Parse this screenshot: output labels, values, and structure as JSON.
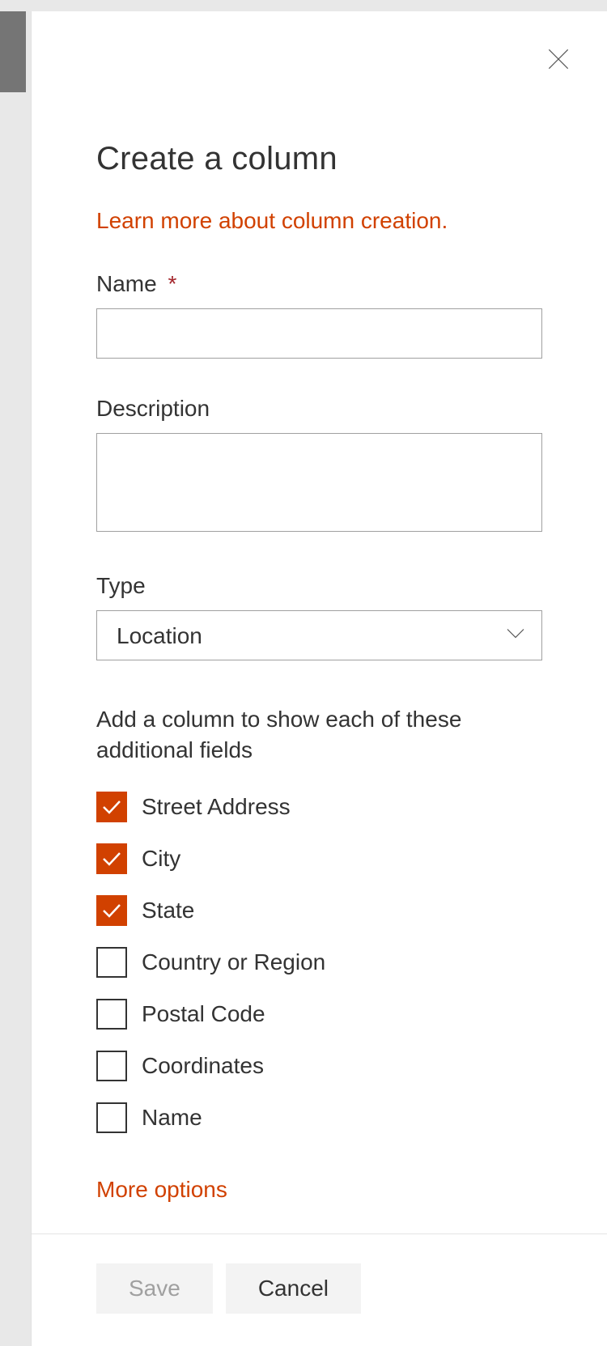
{
  "panel": {
    "title": "Create a column",
    "learn_more": "Learn more about column creation.",
    "more_options": "More options"
  },
  "fields": {
    "name_label": "Name",
    "name_required": "*",
    "name_value": "",
    "description_label": "Description",
    "description_value": "",
    "type_label": "Type",
    "type_value": "Location",
    "additional_hint": "Add a column to show each of these additional fields"
  },
  "checkboxes": [
    {
      "label": "Street Address",
      "checked": true
    },
    {
      "label": "City",
      "checked": true
    },
    {
      "label": "State",
      "checked": true
    },
    {
      "label": "Country or Region",
      "checked": false
    },
    {
      "label": "Postal Code",
      "checked": false
    },
    {
      "label": "Coordinates",
      "checked": false
    },
    {
      "label": "Name",
      "checked": false
    }
  ],
  "footer": {
    "save": "Save",
    "cancel": "Cancel"
  }
}
